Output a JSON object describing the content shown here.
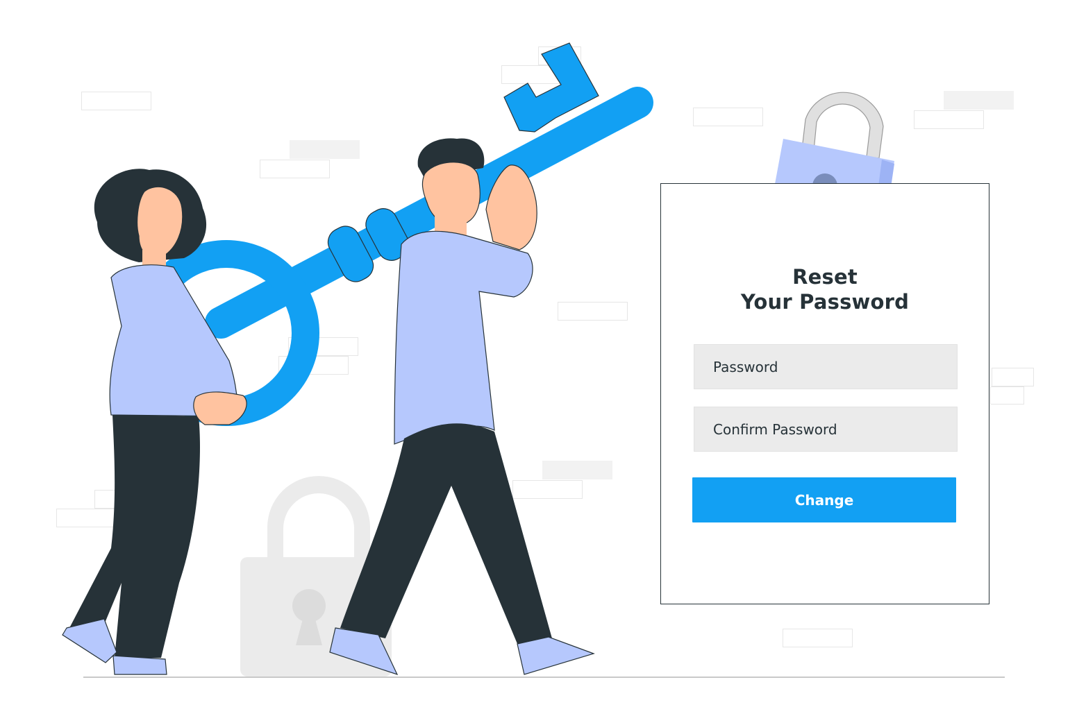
{
  "form": {
    "title_line1": "Reset",
    "title_line2": "Your Password",
    "password_placeholder": "Password",
    "confirm_placeholder": "Confirm Password",
    "submit_label": "Change"
  },
  "colors": {
    "accent": "#12a0f3",
    "ink": "#263238",
    "clothing": "#b6c8fd",
    "field_bg": "#ebebeb",
    "skin": "#ffc3a0"
  },
  "illustration": {
    "subjects": [
      "woman-character",
      "man-character",
      "giant-key",
      "padlock-purple",
      "padlock-gray"
    ]
  }
}
